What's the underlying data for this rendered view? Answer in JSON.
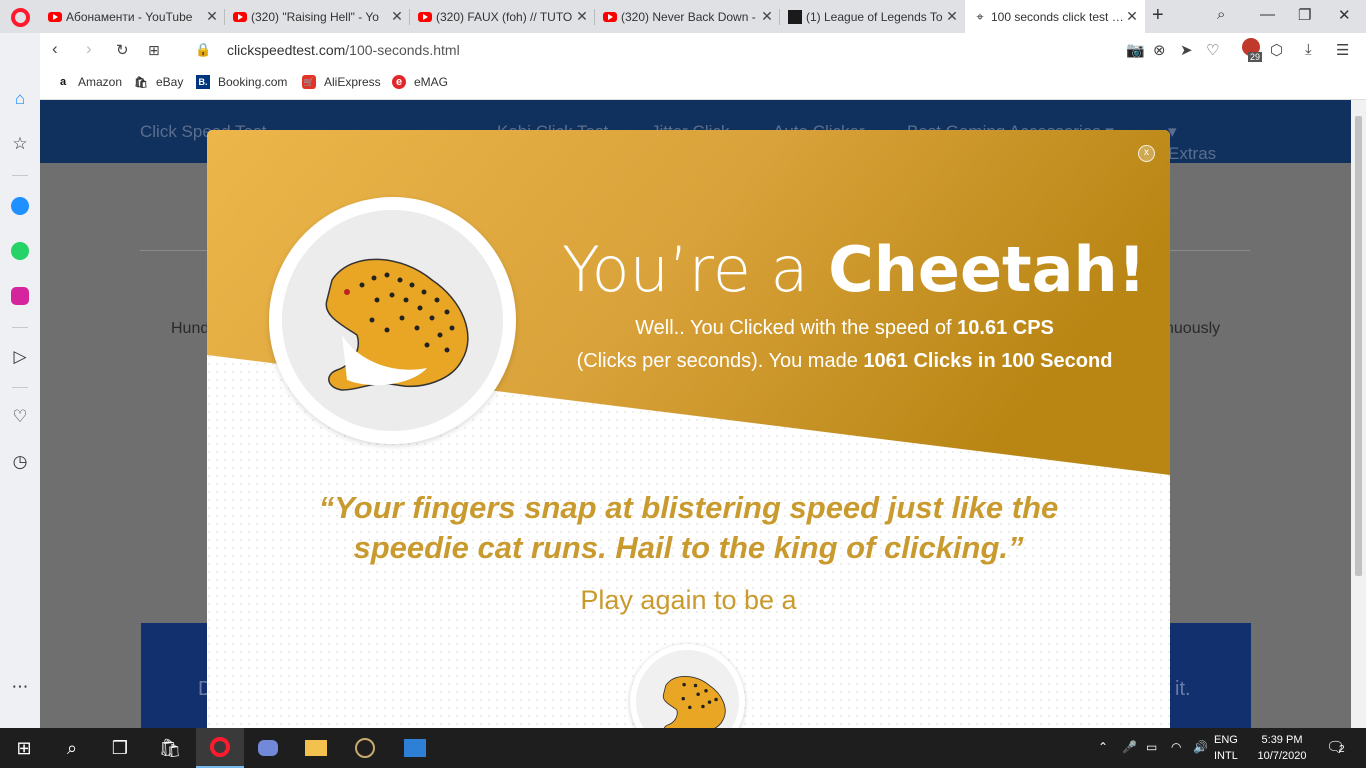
{
  "browser": {
    "tabs": [
      {
        "label": "Абонаменти - YouTube",
        "icon": "youtube-icon"
      },
      {
        "label": "(320) \"Raising Hell\" - Yo",
        "icon": "youtube-icon"
      },
      {
        "label": "(320) FAUX (foh) // TUTO",
        "icon": "youtube-icon"
      },
      {
        "label": "(320) Never Back Down -",
        "icon": "youtube-icon"
      },
      {
        "label": "(1) League of Legends To",
        "icon": "league-icon"
      },
      {
        "label": "100 seconds click test - C",
        "icon": "cursor-icon"
      }
    ],
    "new_tab": "+",
    "url_domain": "clickspeedtest.com",
    "url_path": "/100-seconds.html",
    "adblock_count": "29"
  },
  "bookmarks": [
    {
      "label": "Amazon",
      "icon": "a"
    },
    {
      "label": "eBay",
      "icon": "🛍"
    },
    {
      "label": "Booking.com",
      "icon": "B."
    },
    {
      "label": "AliExpress",
      "icon": "🛒"
    },
    {
      "label": "eMAG",
      "icon": "e"
    }
  ],
  "page": {
    "nav_items": [
      "Click Speed Test",
      "Kohi Click Test",
      "Jitter Click",
      "Auto Clicker",
      "Best Gaming Accessories ▾",
      "Extras"
    ],
    "text_left": "Hund",
    "text_right": "nuously",
    "banner_left": "D",
    "banner_right": "it."
  },
  "modal": {
    "close_label": "x",
    "headline_prefix": "You’re a ",
    "headline_animal": "Cheetah!",
    "line1_prefix": "Well.. You Clicked with the speed of ",
    "line1_value": "10.61 CPS",
    "line2_prefix": "(Clicks per seconds). You made ",
    "line2_value": "1061 Clicks in 100 Second",
    "quote_line1": "“Your fingers snap at blistering speed just like the",
    "quote_line2": "speedie cat runs. Hail to the king of clicking.”",
    "play_again": "Play again to be a",
    "colors": {
      "gold": "#c99a2e",
      "gold_light": "#e9b547",
      "gold_dark": "#b8860b"
    }
  },
  "taskbar": {
    "language_top": "ENG",
    "language_bottom": "INTL",
    "time": "5:39 PM",
    "date": "10/7/2020",
    "notification_count": "2"
  }
}
